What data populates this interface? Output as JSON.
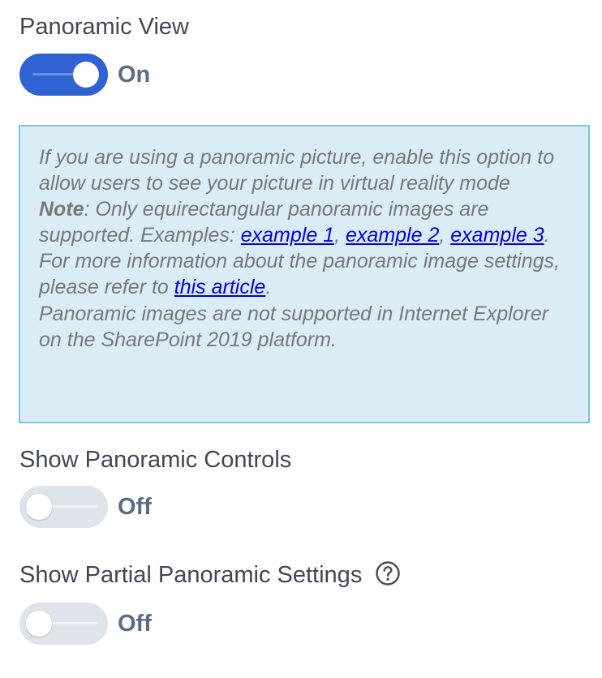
{
  "panoramic_view": {
    "label": "Panoramic View",
    "state": "On",
    "enabled": true
  },
  "info": {
    "line1": "If you are using a panoramic picture, enable this option to allow users to see your picture in virtual reality mode",
    "note_label": "Note",
    "note_text": ": Only equirectangular panoramic images are supported. Examples: ",
    "example1": "example 1",
    "sep1": ", ",
    "example2": "example 2",
    "sep2": ", ",
    "example3": "example 3",
    "end_period": ".",
    "more_text": "For more information about the panoramic image settings, please refer to ",
    "article_link": "this article",
    "more_end": ".",
    "ie_text": "Panoramic images are not supported in Internet Explorer on the SharePoint 2019 platform."
  },
  "panoramic_controls": {
    "label": "Show Panoramic Controls",
    "state": "Off",
    "enabled": false
  },
  "partial_settings": {
    "label": "Show Partial Panoramic Settings",
    "help_icon": "question-circle-icon",
    "state": "Off",
    "enabled": false
  },
  "colors": {
    "toggle_on": "#2f63d4",
    "toggle_off": "#dfe3ea",
    "info_bg": "#daedf7",
    "info_border": "#7fc3e4",
    "link": "#0000e6"
  }
}
